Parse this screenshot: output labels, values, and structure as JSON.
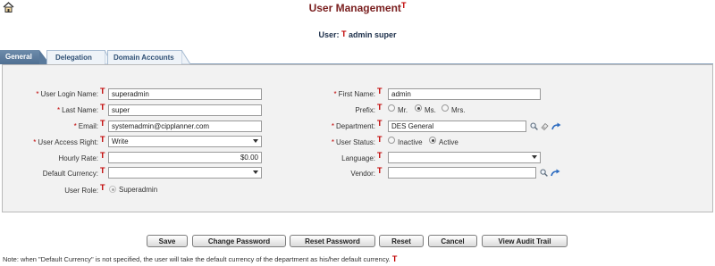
{
  "header": {
    "title": "User Management",
    "title_marker": "T",
    "user_label": "User:",
    "user_marker": "T",
    "user_name": "admin super"
  },
  "tabs": [
    {
      "label": "General",
      "active": true
    },
    {
      "label": "Delegation",
      "active": false
    },
    {
      "label": "Domain Accounts",
      "active": false
    }
  ],
  "marker": "T",
  "required_mark": "*",
  "form": {
    "login_name": {
      "label": "User Login Name:",
      "value": "superadmin"
    },
    "last_name": {
      "label": "Last Name:",
      "value": "super"
    },
    "email": {
      "label": "Email:",
      "value": "systemadmin@cipplanner.com"
    },
    "access_right": {
      "label": "User Access Right:",
      "value": "Write"
    },
    "hourly_rate": {
      "label": "Hourly Rate:",
      "value": "$0.00"
    },
    "default_currency": {
      "label": "Default Currency:",
      "value": ""
    },
    "user_role": {
      "label": "User Role:",
      "option": "Superadmin"
    },
    "first_name": {
      "label": "First Name:",
      "value": "admin"
    },
    "prefix": {
      "label": "Prefix:",
      "options": [
        "Mr.",
        "Ms.",
        "Mrs."
      ],
      "selected": "Ms."
    },
    "department": {
      "label": "Department:",
      "value": "DES General"
    },
    "user_status": {
      "label": "User Status:",
      "options": [
        "Inactive",
        "Active"
      ],
      "selected": "Active"
    },
    "language": {
      "label": "Language:",
      "value": ""
    },
    "vendor": {
      "label": "Vendor:",
      "value": ""
    }
  },
  "buttons": {
    "save": "Save",
    "change_password": "Change Password",
    "reset_password": "Reset Password",
    "reset": "Reset",
    "cancel": "Cancel",
    "audit_trail": "View Audit Trail"
  },
  "note": "Note: when \"Default Currency\" is not specified, the user will take the default currency of the department as his/her default currency.",
  "icons": {
    "home": "home-icon",
    "search": "search-icon",
    "eraser": "eraser-icon",
    "link": "link-arrow-icon"
  },
  "colors": {
    "title": "#7a1f1f",
    "marker": "#c00000",
    "tab_active": "#5a7a9c",
    "panel_bg": "#f2f2f2"
  }
}
